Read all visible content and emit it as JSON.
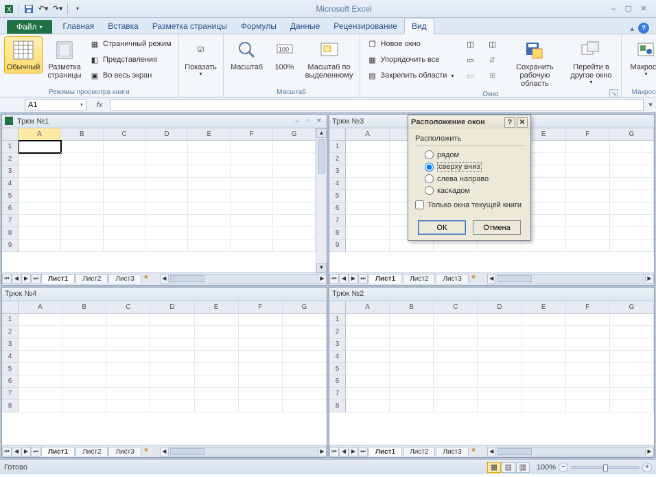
{
  "app": {
    "title": "Microsoft Excel"
  },
  "tabs": {
    "file": "Файл",
    "items": [
      "Главная",
      "Вставка",
      "Разметка страницы",
      "Формулы",
      "Данные",
      "Рецензирование",
      "Вид"
    ],
    "active": "Вид"
  },
  "ribbon": {
    "views": {
      "label": "Режимы просмотра книги",
      "normal": "Обычный",
      "page_layout": "Разметка страницы",
      "page_break": "Страничный режим",
      "custom_views": "Представления",
      "full_screen": "Во весь экран"
    },
    "show": {
      "label": "Показать",
      "btn": "Показать"
    },
    "zoom": {
      "label": "Масштаб",
      "zoom": "Масштаб",
      "p100": "100%",
      "to_sel": "Масштаб по выделенному"
    },
    "window": {
      "label": "Окно",
      "new_win": "Новое окно",
      "arrange": "Упорядочить все",
      "freeze": "Закрепить области",
      "save_ws": "Сохранить рабочую область",
      "switch": "Перейти в другое окно"
    },
    "macros": {
      "label": "Макросы",
      "btn": "Макросы"
    }
  },
  "formula_bar": {
    "cell_ref": "A1",
    "fx": "fx",
    "value": ""
  },
  "workbooks": {
    "columns": [
      "A",
      "B",
      "C",
      "D",
      "E",
      "F",
      "G"
    ],
    "rows": [
      1,
      2,
      3,
      4,
      5,
      6,
      7,
      8,
      9
    ],
    "win1": {
      "title": "Трюк №1",
      "sheets": [
        "Лист1",
        "Лист2",
        "Лист3"
      ],
      "active_sheet": "Лист1",
      "has_wc": true
    },
    "win2": {
      "title": "Трюк №3",
      "sheets": [
        "Лист1",
        "Лист2",
        "Лист3"
      ],
      "active_sheet": "Лист1",
      "has_wc": false
    },
    "win3": {
      "title": "Трюк №4",
      "sheets": [
        "Лист1",
        "Лист2",
        "Лист3"
      ],
      "active_sheet": "Лист1",
      "has_wc": false
    },
    "win4": {
      "title": "Трюк №2",
      "sheets": [
        "Лист1",
        "Лист2",
        "Лист3"
      ],
      "active_sheet": "Лист1",
      "has_wc": false
    }
  },
  "dialog": {
    "title": "Расположение окон",
    "group": "Расположить",
    "opts": {
      "tiled": "рядом",
      "horizontal": "сверху вниз",
      "vertical": "слева направо",
      "cascade": "каскадом"
    },
    "selected": "horizontal",
    "checkbox": "Только окна текущей книги",
    "ok": "ОК",
    "cancel": "Отмена"
  },
  "status": {
    "ready": "Готово",
    "zoom": "100%"
  }
}
